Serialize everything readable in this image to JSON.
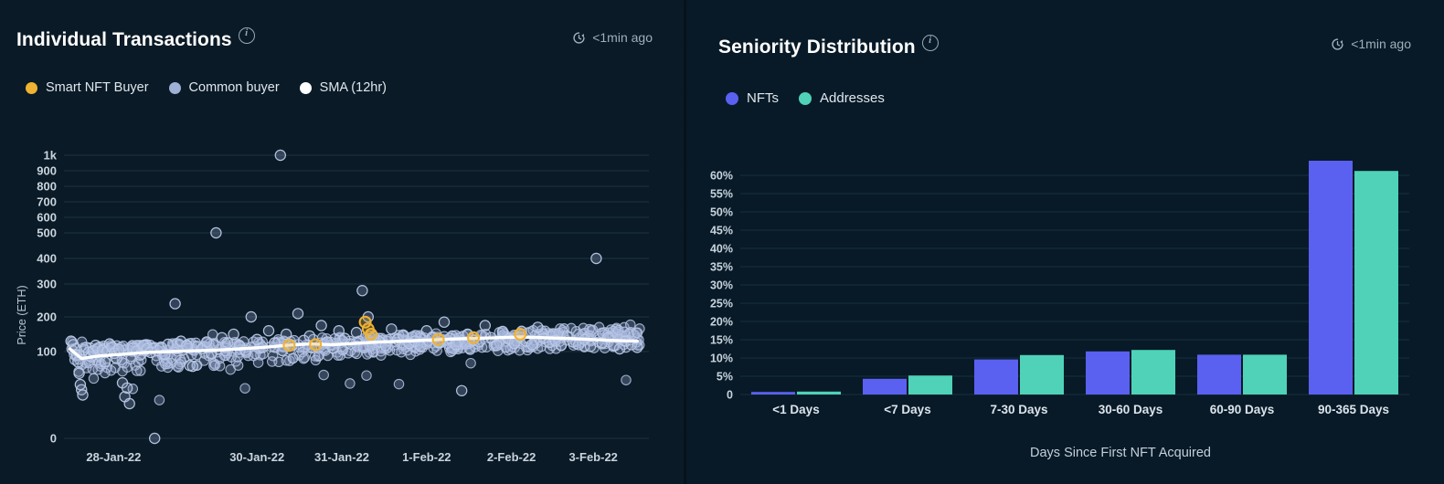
{
  "panels": {
    "left": {
      "title": "Individual Transactions",
      "info_icon": "info-icon",
      "timestamp": "<1min ago",
      "timestamp_icon": "clock-refresh-icon",
      "legend": [
        {
          "label": "Smart NFT Buyer",
          "color": "#f0b232"
        },
        {
          "label": "Common buyer",
          "color": "#9fb0d6"
        },
        {
          "label": "SMA (12hr)",
          "color": "#ffffff"
        }
      ]
    },
    "right": {
      "title": "Seniority Distribution",
      "info_icon": "info-icon",
      "timestamp": "<1min ago",
      "timestamp_icon": "clock-refresh-icon",
      "legend": [
        {
          "label": "NFTs",
          "color": "#5a60f0"
        },
        {
          "label": "Addresses",
          "color": "#4fd2b8"
        }
      ]
    }
  },
  "chart_data": [
    {
      "type": "scatter",
      "title": "Individual Transactions",
      "xlabel": "",
      "ylabel": "Price (ETH)",
      "yscale": "log-like",
      "yticks": [
        "1k",
        "900",
        "800",
        "700",
        "600",
        "500",
        "400",
        "300",
        "200",
        "100",
        "0"
      ],
      "ytick_values": [
        1000,
        900,
        800,
        700,
        600,
        500,
        400,
        300,
        200,
        100,
        0
      ],
      "xticks": [
        "28-Jan-22",
        "30-Jan-22",
        "31-Jan-22",
        "1-Feb-22",
        "2-Feb-22",
        "3-Feb-22"
      ],
      "grid": true,
      "legend_position": "top-left",
      "series": [
        {
          "name": "Common buyer",
          "color": "#9fb0d6",
          "marker": "circle-outline",
          "note": "Dense cloud of transactions mostly between 80 and 200 ETH across the full date range",
          "points": [
            [
              0.012,
              130
            ],
            [
              0.016,
              120
            ],
            [
              0.02,
              108
            ],
            [
              0.022,
              96
            ],
            [
              0.024,
              88
            ],
            [
              0.026,
              75
            ],
            [
              0.028,
              62
            ],
            [
              0.03,
              56
            ],
            [
              0.032,
              50
            ],
            [
              0.034,
              105
            ],
            [
              0.038,
              112
            ],
            [
              0.042,
              99
            ],
            [
              0.046,
              94
            ],
            [
              0.05,
              102
            ],
            [
              0.054,
              118
            ],
            [
              0.058,
              110
            ],
            [
              0.062,
              95
            ],
            [
              0.066,
              104
            ],
            [
              0.07,
              88
            ],
            [
              0.074,
              100
            ],
            [
              0.078,
              122
            ],
            [
              0.082,
              113
            ],
            [
              0.086,
              98
            ],
            [
              0.09,
              92
            ],
            [
              0.094,
              106
            ],
            [
              0.1,
              64
            ],
            [
              0.104,
              48
            ],
            [
              0.108,
              58
            ],
            [
              0.112,
              40
            ],
            [
              0.118,
              110
            ],
            [
              0.124,
              101
            ],
            [
              0.13,
              96
            ],
            [
              0.136,
              118
            ],
            [
              0.142,
              108
            ],
            [
              0.148,
              99
            ],
            [
              0.155,
              0
            ],
            [
              0.16,
              103
            ],
            [
              0.166,
              113
            ],
            [
              0.172,
              97
            ],
            [
              0.178,
              121
            ],
            [
              0.19,
              240
            ],
            [
              0.2,
              130
            ],
            [
              0.21,
              117
            ],
            [
              0.215,
              84
            ],
            [
              0.22,
              83
            ],
            [
              0.228,
              115
            ],
            [
              0.236,
              108
            ],
            [
              0.244,
              128
            ],
            [
              0.252,
              98
            ],
            [
              0.26,
              500
            ],
            [
              0.27,
              140
            ],
            [
              0.28,
              125
            ],
            [
              0.29,
              150
            ],
            [
              0.3,
              118
            ],
            [
              0.31,
              104
            ],
            [
              0.32,
              200
            ],
            [
              0.33,
              135
            ],
            [
              0.34,
              112
            ],
            [
              0.35,
              160
            ],
            [
              0.36,
              125
            ],
            [
              0.37,
              1000
            ],
            [
              0.38,
              150
            ],
            [
              0.39,
              118
            ],
            [
              0.4,
              210
            ],
            [
              0.41,
              132
            ],
            [
              0.42,
              145
            ],
            [
              0.43,
              120
            ],
            [
              0.44,
              175
            ],
            [
              0.45,
              128
            ],
            [
              0.46,
              110
            ],
            [
              0.47,
              160
            ],
            [
              0.48,
              138
            ],
            [
              0.49,
              122
            ],
            [
              0.5,
              155
            ],
            [
              0.51,
              280
            ],
            [
              0.52,
              200
            ],
            [
              0.53,
              142
            ],
            [
              0.54,
              128
            ],
            [
              0.55,
              118
            ],
            [
              0.56,
              165
            ],
            [
              0.57,
              135
            ],
            [
              0.58,
              148
            ],
            [
              0.59,
              124
            ],
            [
              0.6,
              130
            ],
            [
              0.61,
              115
            ],
            [
              0.62,
              160
            ],
            [
              0.63,
              142
            ],
            [
              0.64,
              126
            ],
            [
              0.65,
              185
            ],
            [
              0.66,
              138
            ],
            [
              0.67,
              120
            ],
            [
              0.68,
              55
            ],
            [
              0.69,
              150
            ],
            [
              0.7,
              132
            ],
            [
              0.71,
              128
            ],
            [
              0.72,
              175
            ],
            [
              0.73,
              140
            ],
            [
              0.74,
              118
            ],
            [
              0.75,
              158
            ],
            [
              0.76,
              136
            ],
            [
              0.77,
              124
            ],
            [
              0.78,
              142
            ],
            [
              0.79,
              130
            ],
            [
              0.8,
              120
            ],
            [
              0.81,
              170
            ],
            [
              0.82,
              138
            ],
            [
              0.83,
              126
            ],
            [
              0.84,
              132
            ],
            [
              0.85,
              118
            ],
            [
              0.86,
              145
            ],
            [
              0.87,
              128
            ],
            [
              0.88,
              120
            ],
            [
              0.89,
              135
            ],
            [
              0.9,
              115
            ],
            [
              0.91,
              400
            ],
            [
              0.92,
              125
            ],
            [
              0.93,
              140
            ],
            [
              0.94,
              118
            ],
            [
              0.95,
              108
            ],
            [
              0.96,
              130
            ],
            [
              0.97,
              120
            ],
            [
              0.98,
              112
            ]
          ]
        },
        {
          "name": "Smart NFT Buyer",
          "color": "#f0b232",
          "marker": "circle-outline",
          "points": [
            [
              0.385,
              118
            ],
            [
              0.43,
              120
            ],
            [
              0.515,
              185
            ],
            [
              0.52,
              165
            ],
            [
              0.525,
              150
            ],
            [
              0.64,
              135
            ],
            [
              0.7,
              140
            ],
            [
              0.78,
              150
            ]
          ]
        },
        {
          "name": "SMA (12hr)",
          "color": "#ffffff",
          "marker": "line",
          "points": [
            [
              0.01,
              108
            ],
            [
              0.03,
              92
            ],
            [
              0.06,
              95
            ],
            [
              0.1,
              97
            ],
            [
              0.14,
              99
            ],
            [
              0.18,
              100
            ],
            [
              0.22,
              102
            ],
            [
              0.26,
              104
            ],
            [
              0.3,
              108
            ],
            [
              0.34,
              112
            ],
            [
              0.38,
              118
            ],
            [
              0.42,
              122
            ],
            [
              0.46,
              120
            ],
            [
              0.5,
              124
            ],
            [
              0.54,
              128
            ],
            [
              0.58,
              130
            ],
            [
              0.62,
              133
            ],
            [
              0.66,
              136
            ],
            [
              0.7,
              138
            ],
            [
              0.74,
              140
            ],
            [
              0.78,
              142
            ],
            [
              0.82,
              140
            ],
            [
              0.86,
              138
            ],
            [
              0.9,
              135
            ],
            [
              0.94,
              132
            ],
            [
              0.98,
              130
            ]
          ]
        }
      ]
    },
    {
      "type": "bar",
      "title": "Seniority Distribution",
      "xlabel": "Days Since First NFT Acquired",
      "ylabel": "",
      "categories": [
        "<1 Days",
        "<7 Days",
        "7-30 Days",
        "30-60 Days",
        "60-90 Days",
        "90-365 Days"
      ],
      "yticks": [
        "60%",
        "55%",
        "50%",
        "45%",
        "40%",
        "35%",
        "30%",
        "25%",
        "20%",
        "15%",
        "10%",
        "5%",
        "0"
      ],
      "ytick_values": [
        60,
        55,
        50,
        45,
        40,
        35,
        30,
        25,
        20,
        15,
        10,
        5,
        0
      ],
      "ylim": [
        0,
        65
      ],
      "grid": true,
      "legend_position": "top-left",
      "series": [
        {
          "name": "NFTs",
          "color": "#5a60f0",
          "values": [
            0.7,
            4.3,
            9.6,
            11.8,
            10.9,
            64.0
          ]
        },
        {
          "name": "Addresses",
          "color": "#4fd2b8",
          "values": [
            0.8,
            5.2,
            10.8,
            12.2,
            10.9,
            61.2
          ]
        }
      ]
    }
  ]
}
